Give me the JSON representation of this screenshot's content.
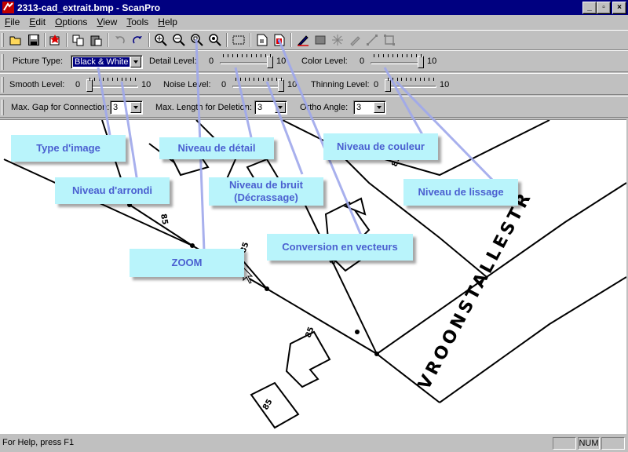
{
  "window": {
    "title": "2313-cad_extrait.bmp - ScanPro"
  },
  "menu": [
    {
      "u": "F",
      "rest": "ile"
    },
    {
      "u": "E",
      "rest": "dit"
    },
    {
      "u": "O",
      "rest": "ptions"
    },
    {
      "u": "V",
      "rest": "iew"
    },
    {
      "u": "T",
      "rest": "ools"
    },
    {
      "u": "H",
      "rest": "elp"
    }
  ],
  "options": {
    "picture_type_label": "Picture Type:",
    "picture_type_value": "Black & White",
    "detail_level_label": "Detail Level:",
    "detail_min": "0",
    "detail_max": "10",
    "detail_value": 10,
    "color_level_label": "Color Level:",
    "color_min": "0",
    "color_max": "10",
    "color_value": 10,
    "smooth_level_label": "Smooth Level:",
    "smooth_min": "0",
    "smooth_max": "10",
    "smooth_value": 0,
    "noise_level_label": "Noise Level:",
    "noise_min": "0",
    "noise_max": "10",
    "noise_value": 10,
    "thinning_level_label": "Thinning Level:",
    "thinning_min": "0",
    "thinning_max": "10",
    "thinning_value": 0,
    "max_gap_label": "Max. Gap for Connection:",
    "max_gap_value": "3",
    "max_length_label": "Max. Length for Deletion:",
    "max_length_value": "3",
    "ortho_angle_label": "Ortho Angle:",
    "ortho_angle_value": "3"
  },
  "callouts": {
    "type_image": "Type d'image",
    "niveau_detail": "Niveau de détail",
    "niveau_couleur": "Niveau de couleur",
    "niveau_arrondi": "Niveau d'arrondi",
    "niveau_bruit_1": "Niveau de bruit",
    "niveau_bruit_2": "(Décrassage)",
    "niveau_lissage": "Niveau de lissage",
    "conversion": "Conversion en vecteurs",
    "zoom": "ZOOM"
  },
  "map_labels": {
    "street": "VROONSTALLESTR",
    "n1": "85",
    "n2": "85",
    "n3": "85",
    "n4": "85",
    "n5": "85",
    "n6": "85"
  },
  "status": {
    "help": "For Help, press F1",
    "num": "NUM"
  }
}
